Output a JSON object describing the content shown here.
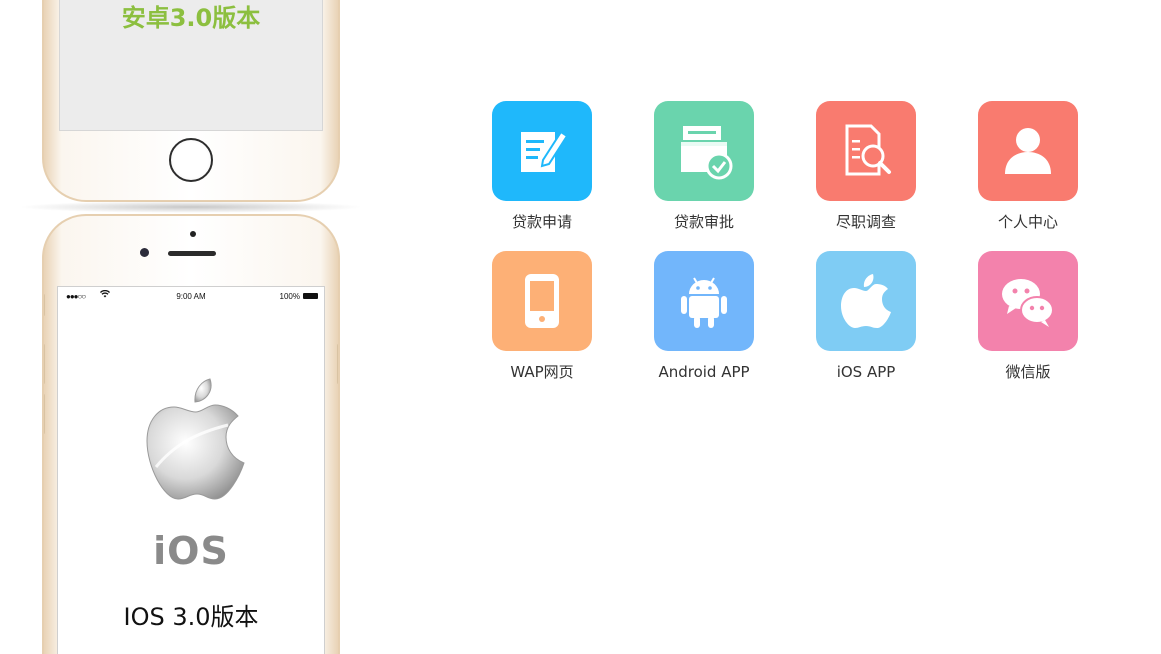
{
  "phones": {
    "android": {
      "screen_title": "安卓3.0版本"
    },
    "ios": {
      "status_carrier": "●●●○○",
      "status_time": "9:00 AM",
      "status_battery": "100%",
      "wordmark": "iOS",
      "screen_title": "IOS 3.0版本"
    }
  },
  "features": [
    {
      "label": "贷款申请",
      "icon": "loan-application-icon",
      "color": "#1fb8fb"
    },
    {
      "label": "贷款审批",
      "icon": "loan-approval-icon",
      "color": "#6ad4ad"
    },
    {
      "label": "尽职调查",
      "icon": "due-diligence-icon",
      "color": "#f97b6f"
    },
    {
      "label": "个人中心",
      "icon": "user-center-icon",
      "color": "#f97b6f"
    },
    {
      "label": "WAP网页",
      "icon": "mobile-wap-icon",
      "color": "#fdb076"
    },
    {
      "label": "Android APP",
      "icon": "android-icon",
      "color": "#72b6fb"
    },
    {
      "label": "iOS APP",
      "icon": "apple-icon",
      "color": "#7fccf4"
    },
    {
      "label": "微信版",
      "icon": "wechat-icon",
      "color": "#f382ac"
    }
  ]
}
